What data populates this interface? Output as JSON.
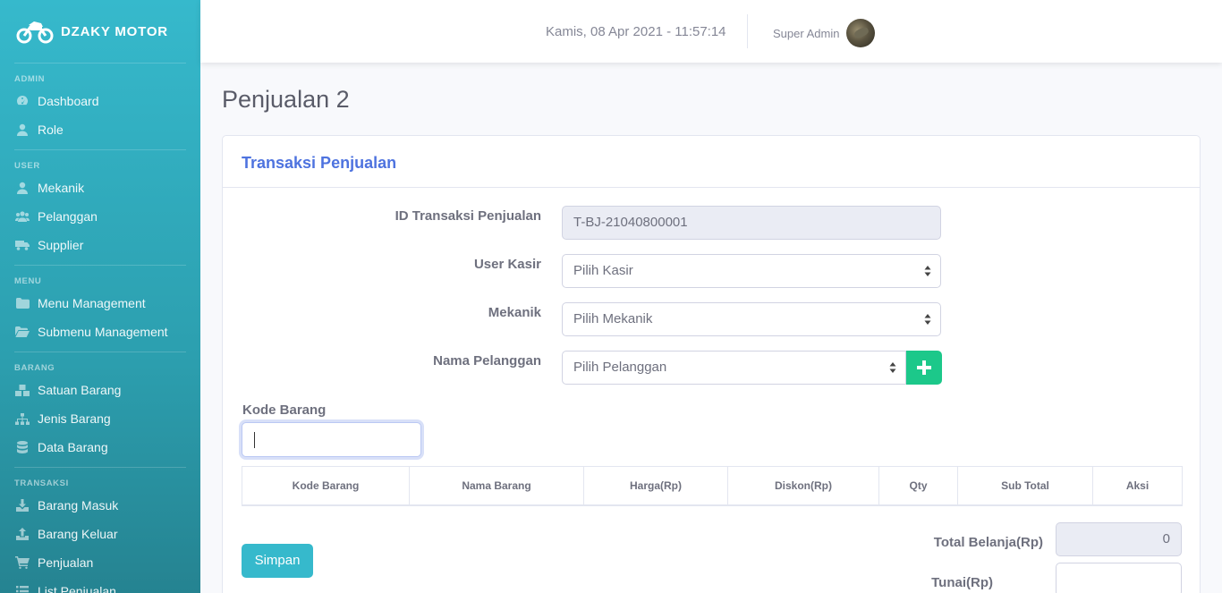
{
  "brand": {
    "name": "DZAKY MOTOR",
    "icon": "motorcycle-icon"
  },
  "sidebar": {
    "sections": [
      {
        "heading": "ADMIN",
        "items": [
          {
            "label": "Dashboard",
            "icon": "dashboard-icon"
          },
          {
            "label": "Role",
            "icon": "user-icon"
          }
        ]
      },
      {
        "heading": "USER",
        "items": [
          {
            "label": "Mekanik",
            "icon": "user-icon"
          },
          {
            "label": "Pelanggan",
            "icon": "users-icon"
          },
          {
            "label": "Supplier",
            "icon": "truck-icon"
          }
        ]
      },
      {
        "heading": "MENU",
        "items": [
          {
            "label": "Menu Management",
            "icon": "folder-icon"
          },
          {
            "label": "Submenu Management",
            "icon": "folder-open-icon"
          }
        ]
      },
      {
        "heading": "BARANG",
        "items": [
          {
            "label": "Satuan Barang",
            "icon": "cubes-icon"
          },
          {
            "label": "Jenis Barang",
            "icon": "sitemap-icon"
          },
          {
            "label": "Data Barang",
            "icon": "database-icon"
          }
        ]
      },
      {
        "heading": "TRANSAKSI",
        "items": [
          {
            "label": "Barang Masuk",
            "icon": "download-icon"
          },
          {
            "label": "Barang Keluar",
            "icon": "upload-icon"
          },
          {
            "label": "Penjualan",
            "icon": "cart-icon"
          },
          {
            "label": "List Penjualan",
            "icon": "list-icon"
          }
        ]
      }
    ]
  },
  "topbar": {
    "datetime": "Kamis, 08 Apr 2021 - 11:57:14",
    "user_name": "Super Admin"
  },
  "page": {
    "title": "Penjualan 2"
  },
  "card": {
    "title": "Transaksi Penjualan"
  },
  "form": {
    "id_transaksi": {
      "label": "ID Transaksi Penjualan",
      "value": "T-BJ-21040800001"
    },
    "user_kasir": {
      "label": "User Kasir",
      "value": "Pilih Kasir"
    },
    "mekanik": {
      "label": "Mekanik",
      "value": "Pilih Mekanik"
    },
    "pelanggan": {
      "label": "Nama Pelanggan",
      "value": "Pilih Pelanggan"
    },
    "kode_barang": {
      "label": "Kode Barang",
      "value": ""
    }
  },
  "table": {
    "headers": [
      "Kode Barang",
      "Nama Barang",
      "Harga(Rp)",
      "Diskon(Rp)",
      "Qty",
      "Sub Total",
      "Aksi"
    ]
  },
  "summary": {
    "total_label": "Total Belanja(Rp)",
    "total_value": "0",
    "tunai_label": "Tunai(Rp)",
    "tunai_value": ""
  },
  "actions": {
    "save_label": "Simpan"
  },
  "colors": {
    "sidebar": "#36b9cc",
    "primary": "#4e73df",
    "success": "#1cc88a",
    "info": "#36b9cc"
  }
}
